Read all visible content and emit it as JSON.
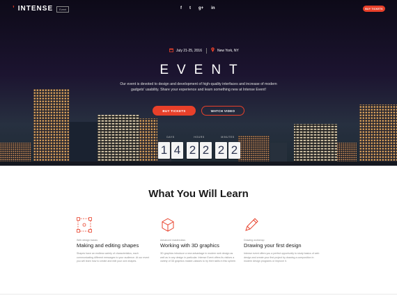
{
  "header": {
    "logo_text": "INTENSE",
    "logo_badge": "Event",
    "social_icons": [
      "facebook-icon",
      "twitter-icon",
      "google-plus-icon",
      "linkedin-icon"
    ],
    "social_glyphs": {
      "facebook": "f",
      "twitter": "t",
      "google": "g+",
      "linkedin": "in"
    },
    "buy_label": "BUY TICKETS"
  },
  "hero": {
    "date": "July 21-25, 2016",
    "location": "New York, NY",
    "title": "EVENT",
    "description": "Our event is devoted to design and development of high-quality interfaces and increase of modern gadgets' usability. Share your experience and learn something new at Intense Event!",
    "buy_label": "BUY TICKETS",
    "watch_label": "WATCH VIDEO"
  },
  "countdown": {
    "units": [
      {
        "label": "DAYS",
        "digits": [
          "1",
          "4"
        ]
      },
      {
        "label": "HOURS",
        "digits": [
          "2",
          "2"
        ]
      },
      {
        "label": "MINUTES",
        "digits": [
          "2",
          "2"
        ]
      }
    ]
  },
  "learn": {
    "title": "What You Will Learn",
    "features": [
      {
        "icon": "vector-shapes-icon",
        "kicker": "Web design basics",
        "title": "Making and editing shapes",
        "text": "Shapes have an endless variety of characteristics, each communicating different messages to your audience. At our event you will learn how to create and edit your own shapes."
      },
      {
        "icon": "3d-cube-icon",
        "kicker": "Advanced masterclass",
        "title": "Working with 3D graphics",
        "text": "3D graphics introduce a new advantage in modern web design as well as in any design in particular. Intense Event offers its visitors a variety of 3D graphics master-classes to try their skills in this sphere."
      },
      {
        "icon": "pencil-icon",
        "kicker": "Drawing workshop",
        "title": "Drawing your first design",
        "text": "Intense event offers you a perfect opportunity to study basics of web design and create your first project by drawing a composition in modern design programs or improve it."
      }
    ]
  },
  "colors": {
    "accent": "#e8402a",
    "hero_bg": "#120d1f",
    "digit": "#2e3550"
  }
}
